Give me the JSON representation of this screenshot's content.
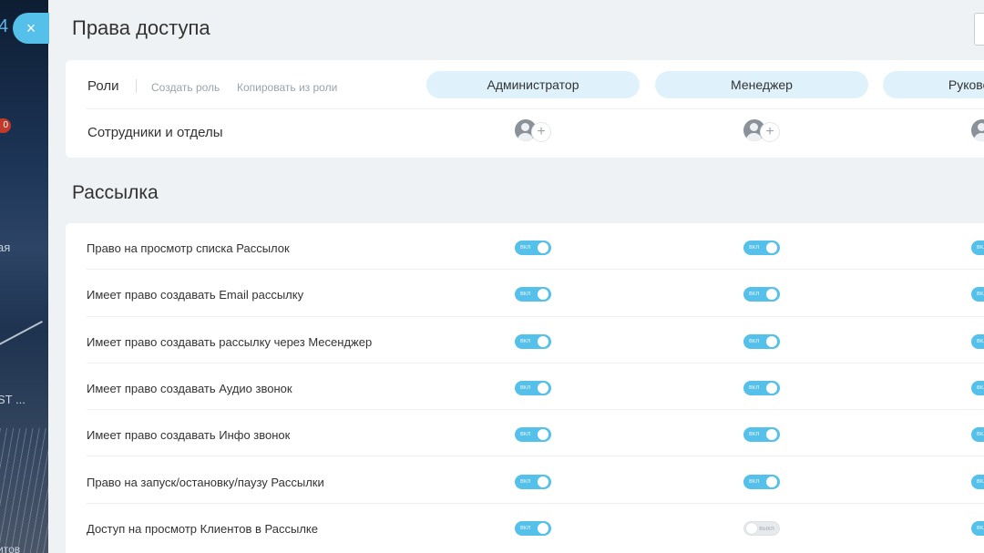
{
  "background": {
    "fragments": [
      "4",
      "0",
      "ая",
      "ST ...",
      "итов"
    ]
  },
  "header": {
    "close_icon": "×",
    "title": "Права доступа"
  },
  "roles": {
    "label": "Роли",
    "create_link": "Создать роль",
    "copy_link": "Копировать из роли",
    "items": [
      "Администратор",
      "Менеджер",
      "Руководитель"
    ],
    "employees_label": "Сотрудники и отделы",
    "add_icon": "+"
  },
  "mailing": {
    "title": "Рассылка",
    "on_text": "вкл",
    "off_text": "выкл",
    "permissions": [
      {
        "label": "Право на просмотр списка Рассылок",
        "values": [
          true,
          true,
          true
        ]
      },
      {
        "label": "Имеет право создавать Email рассылку",
        "values": [
          true,
          true,
          true
        ]
      },
      {
        "label": "Имеет право создавать рассылку через Месенджер",
        "values": [
          true,
          true,
          true
        ]
      },
      {
        "label": "Имеет право создавать Аудио звонок",
        "values": [
          true,
          true,
          true
        ]
      },
      {
        "label": "Имеет право создавать Инфо звонок",
        "values": [
          true,
          true,
          true
        ]
      },
      {
        "label": "Право на запуск/остановку/паузу Рассылки",
        "values": [
          true,
          true,
          true
        ]
      },
      {
        "label": "Доступ на просмотр Клиентов в Рассылке",
        "values": [
          true,
          false,
          true
        ]
      }
    ]
  }
}
